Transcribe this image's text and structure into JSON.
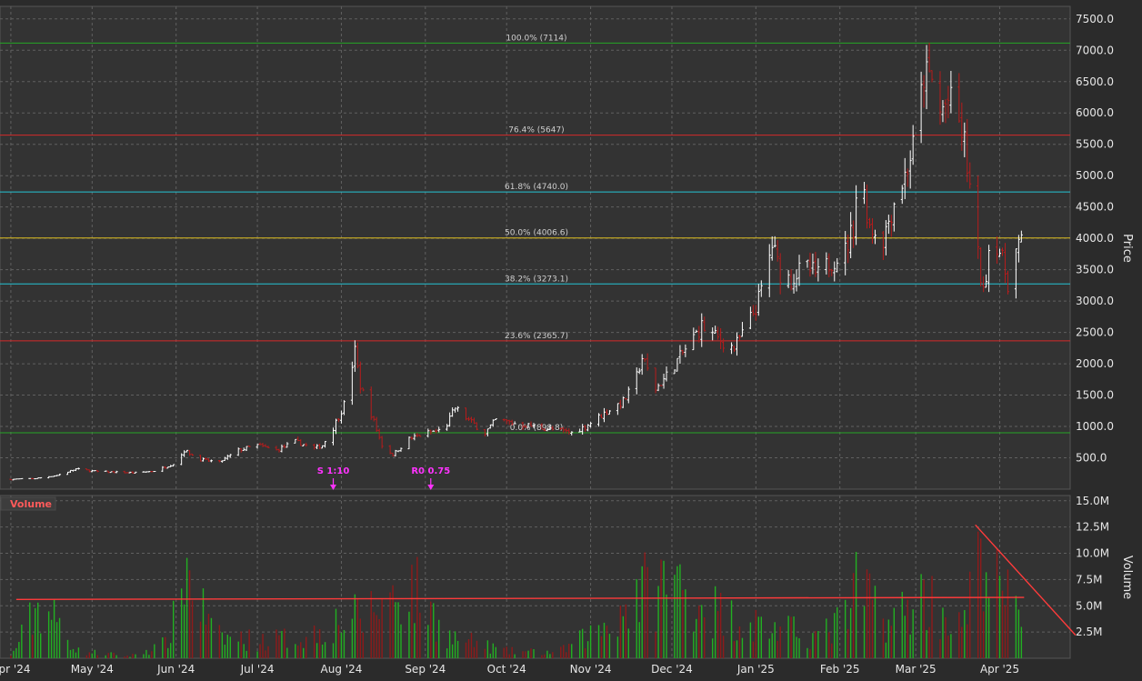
{
  "colors": {
    "background": "#2b2b2b",
    "plot_background": "#333333",
    "grid": "#606060",
    "up": "#ffffff",
    "down": "#b71c1c",
    "vol_up": "#22b022",
    "vol_down": "#8e1a1a",
    "event": "#ff33ff",
    "trend": "#ff3b3b"
  },
  "price_axis": {
    "title": "Price",
    "ticks": [
      "500.0",
      "1000.0",
      "1500.0",
      "2000.0",
      "2500.0",
      "3000.0",
      "3500.0",
      "4000.0",
      "4500.0",
      "5000.0",
      "5500.0",
      "6000.0",
      "6500.0",
      "7000.0",
      "7500.0"
    ]
  },
  "volume_axis": {
    "title": "Volume",
    "ticks": [
      "2.5M",
      "5.0M",
      "7.5M",
      "10.0M",
      "12.5M",
      "15.0M"
    ]
  },
  "x_axis": {
    "ticks": [
      "Apr '24",
      "May '24",
      "Jun '24",
      "Jul '24",
      "Aug '24",
      "Sep '24",
      "Oct '24",
      "Nov '24",
      "Dec '24",
      "Jan '25",
      "Feb '25",
      "Mar '25",
      "Apr '25"
    ]
  },
  "volume_badge": "Volume",
  "fib_levels": [
    {
      "label": "100.0% (7114)",
      "value": 7114,
      "color": "#26a626"
    },
    {
      "label": "76.4% (5647)",
      "value": 5647,
      "color": "#d42a2a"
    },
    {
      "label": "61.8% (4740.0)",
      "value": 4740,
      "color": "#25c4d4"
    },
    {
      "label": "50.0% (4006.6)",
      "value": 4006.6,
      "color": "#e0c020"
    },
    {
      "label": "38.2% (3273.1)",
      "value": 3273.1,
      "color": "#25c4d4"
    },
    {
      "label": "23.6% (2365.7)",
      "value": 2365.7,
      "color": "#d42a2a"
    },
    {
      "label": "0.0% (898.8)",
      "value": 898.8,
      "color": "#26a626"
    }
  ],
  "events": [
    {
      "label": "S 1:10",
      "date": "2024-07-29"
    },
    {
      "label": "R0 0.75",
      "date": "2024-09-03"
    }
  ],
  "chart_data": {
    "type": "candlestick",
    "ylabel": "Price",
    "ylim": [
      0,
      7700
    ],
    "volume_ylabel": "Volume",
    "volume_ylim": [
      0,
      15500000
    ],
    "x_range": [
      "2024-03-28",
      "2025-04-27"
    ],
    "grid": true,
    "price_points": [
      [
        "2024-03-28",
        150
      ],
      [
        "2024-04-10",
        170
      ],
      [
        "2024-04-18",
        220
      ],
      [
        "2024-04-25",
        320
      ],
      [
        "2024-05-03",
        280
      ],
      [
        "2024-05-10",
        270
      ],
      [
        "2024-05-17",
        260
      ],
      [
        "2024-05-24",
        290
      ],
      [
        "2024-06-01",
        420
      ],
      [
        "2024-06-04",
        620
      ],
      [
        "2024-06-10",
        470
      ],
      [
        "2024-06-17",
        430
      ],
      [
        "2024-06-24",
        620
      ],
      [
        "2024-07-01",
        700
      ],
      [
        "2024-07-08",
        620
      ],
      [
        "2024-07-15",
        760
      ],
      [
        "2024-07-22",
        650
      ],
      [
        "2024-07-25",
        700
      ],
      [
        "2024-07-29",
        980
      ],
      [
        "2024-08-02",
        1350
      ],
      [
        "2024-08-06",
        2200
      ],
      [
        "2024-08-08",
        1650
      ],
      [
        "2024-08-12",
        1200
      ],
      [
        "2024-08-16",
        700
      ],
      [
        "2024-08-20",
        550
      ],
      [
        "2024-08-26",
        800
      ],
      [
        "2024-09-02",
        900
      ],
      [
        "2024-09-08",
        950
      ],
      [
        "2024-09-12",
        1300
      ],
      [
        "2024-09-17",
        1100
      ],
      [
        "2024-09-23",
        900
      ],
      [
        "2024-09-27",
        1100
      ],
      [
        "2024-10-04",
        1050
      ],
      [
        "2024-10-11",
        1000
      ],
      [
        "2024-10-18",
        950
      ],
      [
        "2024-10-25",
        900
      ],
      [
        "2024-10-30",
        1000
      ],
      [
        "2024-11-04",
        1150
      ],
      [
        "2024-11-09",
        1300
      ],
      [
        "2024-11-13",
        1400
      ],
      [
        "2024-11-17",
        1650
      ],
      [
        "2024-11-20",
        2100
      ],
      [
        "2024-11-25",
        1600
      ],
      [
        "2024-11-28",
        1750
      ],
      [
        "2024-12-03",
        2050
      ],
      [
        "2024-12-08",
        2350
      ],
      [
        "2024-12-12",
        2600
      ],
      [
        "2024-12-18",
        2400
      ],
      [
        "2024-12-24",
        2250
      ],
      [
        "2024-12-28",
        2550
      ],
      [
        "2025-01-01",
        2900
      ],
      [
        "2025-01-04",
        3300
      ],
      [
        "2025-01-07",
        3900
      ],
      [
        "2025-01-10",
        3450
      ],
      [
        "2025-01-14",
        3350
      ],
      [
        "2025-01-19",
        3550
      ],
      [
        "2025-01-24",
        3400
      ],
      [
        "2025-01-29",
        3650
      ],
      [
        "2025-02-03",
        3800
      ],
      [
        "2025-02-06",
        4200
      ],
      [
        "2025-02-08",
        5200
      ],
      [
        "2025-02-12",
        4200
      ],
      [
        "2025-02-17",
        4000
      ],
      [
        "2025-02-21",
        4600
      ],
      [
        "2025-02-25",
        5000
      ],
      [
        "2025-03-01",
        5600
      ],
      [
        "2025-03-04",
        6600
      ],
      [
        "2025-03-07",
        6500
      ],
      [
        "2025-03-10",
        6000
      ],
      [
        "2025-03-13",
        6200
      ],
      [
        "2025-03-16",
        6000
      ],
      [
        "2025-03-19",
        5500
      ],
      [
        "2025-03-21",
        4800
      ],
      [
        "2025-03-24",
        3700
      ],
      [
        "2025-03-26",
        3100
      ],
      [
        "2025-03-29",
        4200
      ],
      [
        "2025-04-01",
        3800
      ],
      [
        "2025-04-04",
        3300
      ],
      [
        "2025-04-06",
        3700
      ],
      [
        "2025-04-08",
        3900
      ]
    ],
    "volume_levels": [
      [
        "2024-04-01",
        0.3
      ],
      [
        "2024-04-12",
        8.0
      ],
      [
        "2024-04-26",
        1.0
      ],
      [
        "2024-05-15",
        0.3
      ],
      [
        "2024-05-28",
        2.0
      ],
      [
        "2024-06-01",
        6.0
      ],
      [
        "2024-06-04",
        13.5
      ],
      [
        "2024-06-15",
        3.0
      ],
      [
        "2024-07-01",
        2.5
      ],
      [
        "2024-07-20",
        3.0
      ],
      [
        "2024-07-29",
        5.0
      ],
      [
        "2024-08-10",
        6.0
      ],
      [
        "2024-08-26",
        10.5
      ],
      [
        "2024-09-10",
        3.0
      ],
      [
        "2024-10-01",
        1.0
      ],
      [
        "2024-10-20",
        0.8
      ],
      [
        "2024-11-04",
        4.0
      ],
      [
        "2024-11-10",
        6.0
      ],
      [
        "2024-11-18",
        9.0
      ],
      [
        "2024-12-01",
        11.0
      ],
      [
        "2024-12-20",
        6.0
      ],
      [
        "2025-01-10",
        4.0
      ],
      [
        "2025-01-25",
        3.0
      ],
      [
        "2025-02-04",
        6.0
      ],
      [
        "2025-02-08",
        10.5
      ],
      [
        "2025-02-20",
        5.0
      ],
      [
        "2025-03-04",
        9.0
      ],
      [
        "2025-03-18",
        4.0
      ],
      [
        "2025-03-26",
        15.0
      ],
      [
        "2025-04-01",
        9.0
      ],
      [
        "2025-04-08",
        7.0
      ]
    ],
    "volume_trendlines": [
      {
        "from": [
          "2024-04-03",
          5600000
        ],
        "to": [
          "2025-04-10",
          5800000
        ]
      },
      {
        "from": [
          "2025-03-23",
          12700000
        ],
        "to": [
          "2025-04-29",
          2200000
        ]
      }
    ]
  }
}
